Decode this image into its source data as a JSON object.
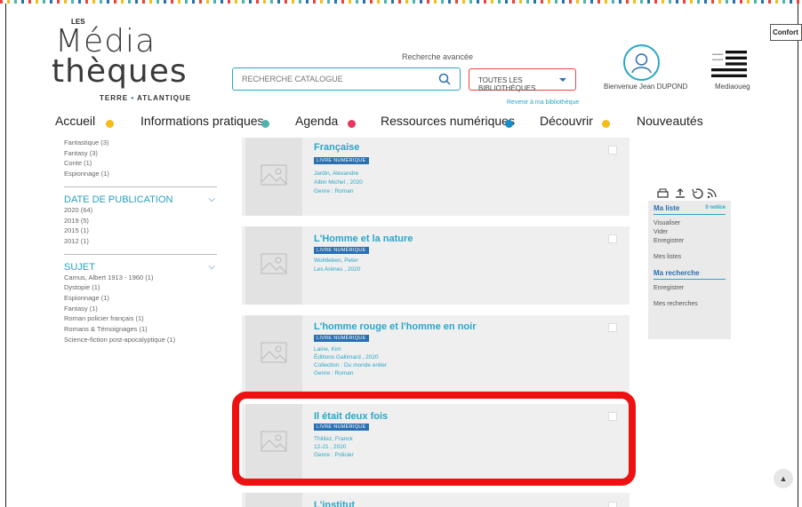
{
  "header": {
    "logo": {
      "les": "LES",
      "line1": "Média",
      "line2": "thèques",
      "subtitle_left": "TERRE",
      "subtitle_right": "ATLANTIQUE"
    },
    "confort_label": "Confort",
    "confort_plus": "+",
    "advanced_search": "Recherche avancée",
    "search_placeholder": "RECHERCHE CATALOGUE",
    "library_select": "TOUTES LES BIBLIOTHÈQUES",
    "back_to_library": "Revenir à ma bibliothèque",
    "welcome": "Bienvenue Jean DUPOND",
    "mediaoueg": "Mediaoueg"
  },
  "nav": [
    {
      "label": "Accueil",
      "color": "#f3bd1b"
    },
    {
      "label": "Informations pratiques",
      "color": "#4fb3a9"
    },
    {
      "label": "Agenda",
      "color": "#e8365c"
    },
    {
      "label": "Ressources numériques",
      "color": "#1a8fc7"
    },
    {
      "label": "Découvrir",
      "color": "#f3bd1b"
    },
    {
      "label": "Nouveautés",
      "color": ""
    }
  ],
  "facets": {
    "genre_items": [
      "Fantastique (3)",
      "Fantasy (3)",
      "Conte (1)",
      "Espionnage (1)"
    ],
    "date": {
      "title": "DATE DE PUBLICATION",
      "items": [
        "2020 (64)",
        "2019 (5)",
        "2015 (1)",
        "2012 (1)"
      ]
    },
    "subject": {
      "title": "SUJET",
      "items": [
        "Camus, Albert 1913 - 1960 (1)",
        "Dystopie (1)",
        "Espionnage (1)",
        "Fantasy (1)",
        "Roman policier français (1)",
        "Romans & Témoignages (1)",
        "Science-fiction post-apocalyptique (1)"
      ]
    }
  },
  "results": [
    {
      "title": "Française",
      "badge": "LIVRE NUMÉRIQUE",
      "meta": [
        "Jardin, Alexandre",
        "Albin Michel , 2020",
        "Genre : Roman"
      ]
    },
    {
      "title": "L'Homme et la nature",
      "badge": "LIVRE NUMÉRIQUE",
      "meta": [
        "Wohlleben, Peter",
        "Les Arènes , 2020"
      ]
    },
    {
      "title": "L'homme rouge et l'homme en noir",
      "badge": "LIVRE NUMÉRIQUE",
      "meta": [
        "Laine, Kim",
        "Éditions Gallimard , 2020",
        "Collection : Du monde entier",
        "Genre : Roman"
      ]
    },
    {
      "title": "Il était deux fois",
      "badge": "LIVRE NUMÉRIQUE",
      "meta": [
        "Thilliez, Franck",
        "12-21 , 2020",
        "Genre : Policier"
      ]
    },
    {
      "title": "L'institut",
      "badge": "",
      "meta": []
    }
  ],
  "side": {
    "my_list": "Ma liste",
    "notice_count": "0 notice",
    "view": "Visualiser",
    "empty": "Vider",
    "save": "Enregistrer",
    "my_lists": "Mes listes",
    "my_search": "Ma recherche",
    "save_search": "Enregistrer",
    "my_searches": "Mes recherches"
  },
  "scroll_top": "▲"
}
